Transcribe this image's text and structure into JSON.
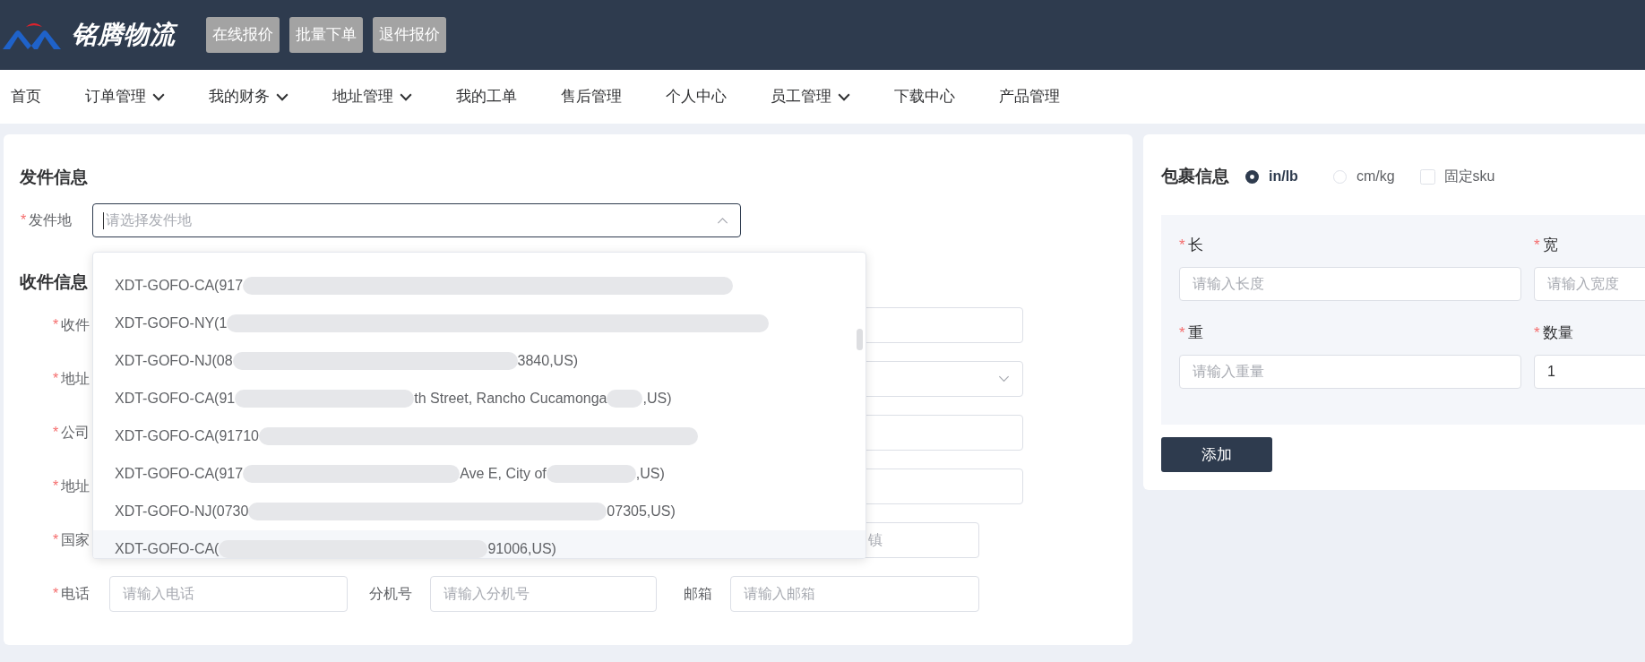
{
  "header": {
    "logo_text": "铭腾物流",
    "buttons": [
      "在线报价",
      "批量下单",
      "退件报价"
    ]
  },
  "nav": [
    {
      "label": "首页",
      "has_menu": false
    },
    {
      "label": "订单管理",
      "has_menu": true
    },
    {
      "label": "我的财务",
      "has_menu": true
    },
    {
      "label": "地址管理",
      "has_menu": true
    },
    {
      "label": "我的工单",
      "has_menu": false
    },
    {
      "label": "售后管理",
      "has_menu": false
    },
    {
      "label": "个人中心",
      "has_menu": false
    },
    {
      "label": "员工管理",
      "has_menu": true
    },
    {
      "label": "下载中心",
      "has_menu": false
    },
    {
      "label": "产品管理",
      "has_menu": false
    }
  ],
  "sender": {
    "title": "发件信息",
    "origin": {
      "mark": "*",
      "label": "发件地",
      "placeholder": "请选择发件地",
      "open": true
    },
    "options": [
      {
        "highlighted": false,
        "segments": [
          {
            "kind": "text",
            "text": "XDT-GOFO-CA(917"
          },
          {
            "kind": "smear"
          }
        ]
      },
      {
        "highlighted": false,
        "segments": [
          {
            "kind": "text",
            "text": "XDT-GOFO-NY(1"
          },
          {
            "kind": "smear"
          }
        ]
      },
      {
        "highlighted": false,
        "segments": [
          {
            "kind": "text",
            "text": "XDT-GOFO-NJ(08"
          },
          {
            "kind": "smear"
          },
          {
            "kind": "text",
            "text": "3840,US)"
          }
        ]
      },
      {
        "highlighted": false,
        "segments": [
          {
            "kind": "text",
            "text": "XDT-GOFO-CA(91"
          },
          {
            "kind": "smear"
          },
          {
            "kind": "text",
            "text": "th Street, Rancho Cucamonga"
          },
          {
            "kind": "smear"
          },
          {
            "kind": "text",
            "text": ",US)"
          }
        ]
      },
      {
        "highlighted": false,
        "segments": [
          {
            "kind": "text",
            "text": "XDT-GOFO-CA(91710"
          },
          {
            "kind": "smear"
          }
        ]
      },
      {
        "highlighted": false,
        "segments": [
          {
            "kind": "text",
            "text": "XDT-GOFO-CA(917"
          },
          {
            "kind": "smear"
          },
          {
            "kind": "text",
            "text": "Ave E, City of"
          },
          {
            "kind": "smear"
          },
          {
            "kind": "text",
            "text": ",US)"
          }
        ]
      },
      {
        "highlighted": false,
        "segments": [
          {
            "kind": "text",
            "text": "XDT-GOFO-NJ(0730"
          },
          {
            "kind": "smear"
          },
          {
            "kind": "text",
            "text": "07305,US)"
          }
        ]
      },
      {
        "highlighted": true,
        "segments": [
          {
            "kind": "text",
            "text": "XDT-GOFO-CA("
          },
          {
            "kind": "smear"
          },
          {
            "kind": "text",
            "text": "91006,US)"
          }
        ]
      }
    ]
  },
  "recipient": {
    "title": "收件信息",
    "rows": [
      {
        "kind": "wide",
        "mark": "*",
        "label": "收件",
        "fields": [
          {
            "kind": "input"
          }
        ]
      },
      {
        "kind": "wide",
        "mark": "*",
        "label": "地址",
        "fields": [
          {
            "kind": "select"
          }
        ]
      },
      {
        "kind": "wide",
        "mark": "*",
        "label": "公司",
        "fields": [
          {
            "kind": "input"
          }
        ]
      },
      {
        "kind": "wide",
        "mark": "*",
        "label": "地址",
        "fields": [
          {
            "kind": "input"
          }
        ]
      },
      {
        "kind": "split",
        "mark": "*",
        "label": "国家",
        "fields": [
          {
            "kind": "input",
            "placeholder": "镇"
          }
        ]
      },
      {
        "kind": "split",
        "mark": "*",
        "label": "电话",
        "fields": [
          {
            "kind": "input",
            "placeholder": "请输入电话"
          },
          {
            "kind": "input",
            "label": "分机号",
            "placeholder": "请输入分机号"
          },
          {
            "kind": "input",
            "label": "邮箱",
            "placeholder": "请输入邮箱"
          }
        ]
      }
    ]
  },
  "package": {
    "title": "包裹信息",
    "units": [
      {
        "label": "in/lb",
        "selected": true
      },
      {
        "label": "cm/kg",
        "selected": false
      }
    ],
    "fixed_sku": {
      "label": "固定sku",
      "checked": false
    },
    "fields": [
      {
        "mark": "*",
        "label": "长",
        "placeholder": "请输入长度"
      },
      {
        "mark": "*",
        "label": "宽",
        "placeholder": "请输入宽度"
      },
      {
        "mark": "*",
        "label": "重",
        "placeholder": "请输入重量"
      },
      {
        "mark": "*",
        "label": "数量",
        "value": "1"
      }
    ],
    "add_button": "添加"
  }
}
